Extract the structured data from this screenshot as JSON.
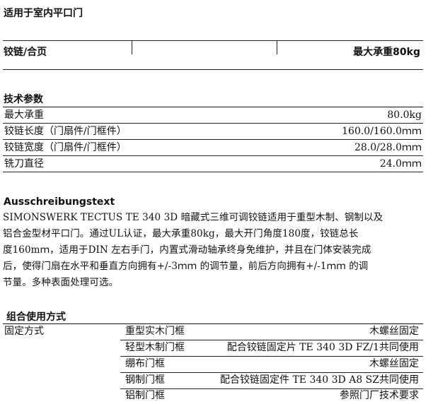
{
  "header": {
    "title": "适用于室内平口门"
  },
  "hinge_row": {
    "label": "铰链/合页",
    "max_load": "最大承重80kg"
  },
  "tech_params": {
    "heading": "技术参数",
    "rows": [
      {
        "label": "最大承重",
        "value": "80.0kg"
      },
      {
        "label": "铰链长度（门扇件/门框件）",
        "value": "160.0/160.0ｍｍ"
      },
      {
        "label": "铰链宽度（门扇件/门框件）",
        "value": "28.0/28.0ｍｍ"
      },
      {
        "label": "铣刀直径",
        "value": "24.0ｍｍ"
      }
    ]
  },
  "tender": {
    "heading": "Ausschreibungstext",
    "lines": [
      "SIMONSWERK TECTUS TE 340 3D 暗藏式三维可调铰链适用于重型木制、钢制以及",
      "铝合金型材平口门。通过UL认证，最大承重80kg，最大开门角度180度，铰链总长",
      "度160mｍ，适用于DIN 左右手门，内置式滑动轴承终身免维护，并且在门体安装完成",
      "后，使得门扇在水平和垂直方向拥有+/-3ｍｍ 的调节量，前后方向拥有+/-1ｍｍ 的调",
      "节量。多种表面处理可选。"
    ]
  },
  "combination": {
    "heading": "组合使用方式",
    "fixing_label": "固定方式",
    "rows": [
      {
        "frame": "重型实木门框",
        "method": "木螺丝固定"
      },
      {
        "frame": "轻型木制门框",
        "method": "配合铰链固定片 TE 340 3D FZ/1共同使用"
      },
      {
        "frame": "绷布门框",
        "method": "木螺丝固定"
      },
      {
        "frame": "钢制门框",
        "method": "配合铰链固定件 TE 340 3D A8 SZ共同使用"
      },
      {
        "frame": "铝制门框",
        "method": "参照门厂技术要求"
      }
    ]
  }
}
